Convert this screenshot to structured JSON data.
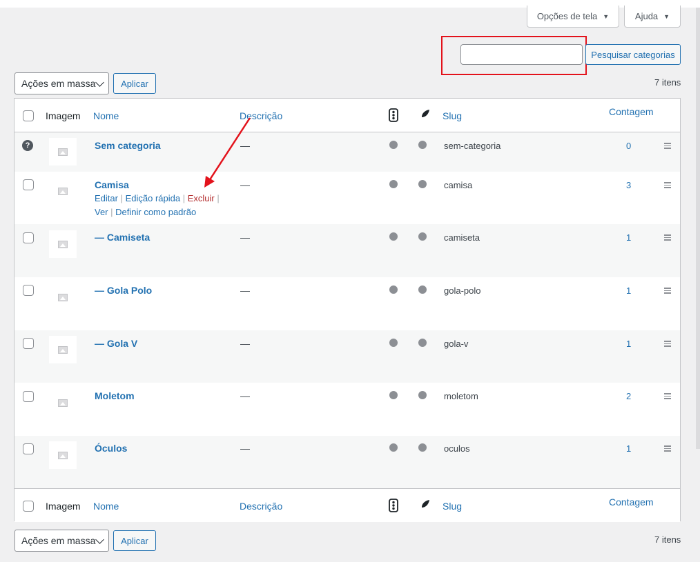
{
  "screen_options": {
    "label": "Opções de tela"
  },
  "help": {
    "label": "Ajuda"
  },
  "search": {
    "value": "",
    "button": "Pesquisar categorias"
  },
  "bulk_top": {
    "select": "Ações em massa",
    "apply": "Aplicar",
    "count": "7 itens"
  },
  "bulk_bottom": {
    "select": "Ações em massa",
    "apply": "Aplicar",
    "count": "7 itens"
  },
  "columns": {
    "image": "Imagem",
    "name": "Nome",
    "description": "Descrição",
    "slug": "Slug",
    "count": "Contagem"
  },
  "rows": [
    {
      "name": "Sem categoria",
      "description": "—",
      "slug": "sem-categoria",
      "count": "0"
    },
    {
      "name": "Camisa",
      "description": "—",
      "slug": "camisa",
      "count": "3",
      "actions": {
        "edit": "Editar",
        "quick_edit": "Edição rápida",
        "delete": "Excluir",
        "view": "Ver",
        "make_default": "Definir como padrão",
        "sep": "|"
      }
    },
    {
      "name": "— Camiseta",
      "description": "—",
      "slug": "camiseta",
      "count": "1"
    },
    {
      "name": "— Gola Polo",
      "description": "—",
      "slug": "gola-polo",
      "count": "1"
    },
    {
      "name": "— Gola V",
      "description": "—",
      "slug": "gola-v",
      "count": "1"
    },
    {
      "name": "Moletom",
      "description": "—",
      "slug": "moletom",
      "count": "2"
    },
    {
      "name": "Óculos",
      "description": "—",
      "slug": "oculos",
      "count": "1"
    }
  ],
  "colors": {
    "link": "#2271b1",
    "delete": "#b32d2e",
    "highlight": "#e3121b",
    "arrow": "#e3121b"
  },
  "icons": {
    "header_col_1": "traffic-light-icon",
    "header_col_2": "feather-icon",
    "row_handle": "drag-handle-icon",
    "default_row": "question-mark-icon"
  }
}
